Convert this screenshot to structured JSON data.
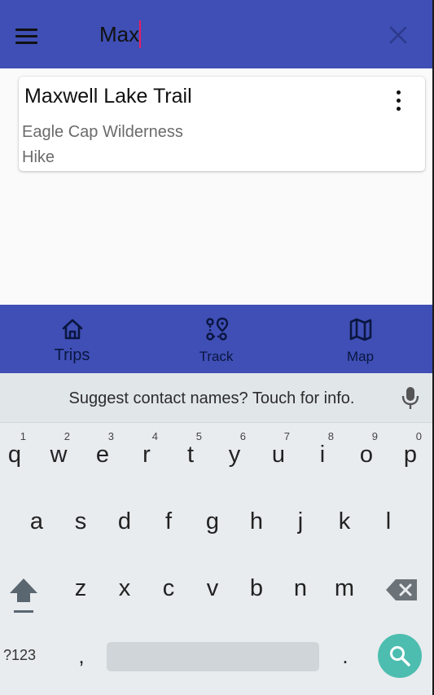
{
  "appbar": {
    "background": "#3f4fb5",
    "menu_icon": "hamburger-menu-icon",
    "search_value": "Max",
    "clear_icon": "close-icon"
  },
  "results": [
    {
      "title": "Maxwell Lake Trail",
      "area": "Eagle Cap Wilderness",
      "type": "Hike",
      "more_icon": "more-vert-icon"
    }
  ],
  "bottom_nav": {
    "items": [
      {
        "label": "Trips",
        "icon": "home-icon"
      },
      {
        "label": "Track",
        "icon": "route-icon"
      },
      {
        "label": "Map",
        "icon": "map-icon"
      }
    ]
  },
  "keyboard": {
    "suggestion": "Suggest contact names? Touch for info.",
    "mic_icon": "microphone-icon",
    "row1": [
      {
        "ch": "q",
        "hint": "1"
      },
      {
        "ch": "w",
        "hint": "2"
      },
      {
        "ch": "e",
        "hint": "3"
      },
      {
        "ch": "r",
        "hint": "4"
      },
      {
        "ch": "t",
        "hint": "5"
      },
      {
        "ch": "y",
        "hint": "6"
      },
      {
        "ch": "u",
        "hint": "7"
      },
      {
        "ch": "i",
        "hint": "8"
      },
      {
        "ch": "o",
        "hint": "9"
      },
      {
        "ch": "p",
        "hint": "0"
      }
    ],
    "row2": [
      "a",
      "s",
      "d",
      "f",
      "g",
      "h",
      "j",
      "k",
      "l"
    ],
    "row3": [
      "z",
      "x",
      "c",
      "v",
      "b",
      "n",
      "m"
    ],
    "symbols_label": "?123",
    "comma": ",",
    "period": ".",
    "search_key_icon": "search-icon",
    "shift_icon": "shift-icon",
    "backspace_icon": "backspace-icon",
    "accent": "#4dbdb0"
  }
}
